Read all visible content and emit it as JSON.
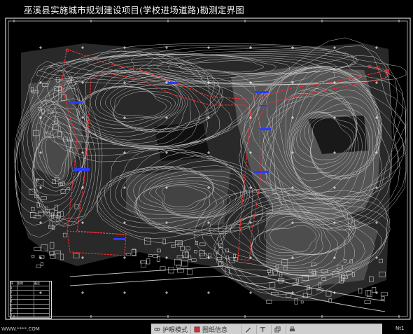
{
  "drawing": {
    "title": "巫溪县实施城市规划建设项目(学校进场道路)勘测定界图",
    "status_left": "WWW.****.COM",
    "page_label": "Nt1"
  },
  "legend": {
    "cells": [
      "序",
      "名称",
      "备注",
      "1",
      "",
      "",
      "2",
      "",
      "",
      "3",
      "",
      "",
      "4",
      "",
      "",
      "5",
      "",
      "",
      "6",
      "",
      "",
      "7",
      "",
      ""
    ]
  },
  "toolbar": {
    "items": [
      {
        "icon": "glasses-icon",
        "label": "护眼模式"
      },
      {
        "icon": "layer-icon",
        "label": "图纸信息"
      },
      {
        "icon": "pen-icon",
        "label": ""
      },
      {
        "icon": "text-icon",
        "label": ""
      },
      {
        "icon": "copy-icon",
        "label": ""
      },
      {
        "icon": "print-icon",
        "label": ""
      }
    ]
  },
  "colors": {
    "background": "#000000",
    "contour": "#cfcfcf",
    "boundary": "#ff2a2a",
    "water": "#2b3bff",
    "frame": "#ffffff"
  }
}
